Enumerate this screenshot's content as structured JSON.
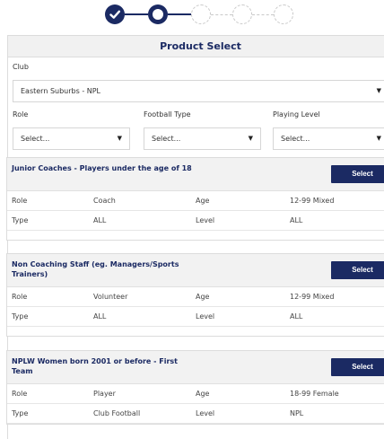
{
  "stepper": {
    "steps": [
      "done",
      "current",
      "todo",
      "todo",
      "todo"
    ],
    "accent": "#1b2a63"
  },
  "panel": {
    "title": "Product Select"
  },
  "filters": {
    "club_label": "Club",
    "club_value": "Eastern Suburbs - NPL",
    "role_label": "Role",
    "role_value": "Select...",
    "football_type_label": "Football Type",
    "football_type_value": "Select...",
    "playing_level_label": "Playing Level",
    "playing_level_value": "Select..."
  },
  "products": [
    {
      "title": "Junior Coaches - Players under the age of 18",
      "button": "Select",
      "role_label": "Role",
      "role": "Coach",
      "age_label": "Age",
      "age": "12-99 Mixed",
      "type_label": "Type",
      "type": "ALL",
      "level_label": "Level",
      "level": "ALL"
    },
    {
      "title": "Non Coaching Staff (eg. Managers/Sports Trainers)",
      "button": "Select",
      "role_label": "Role",
      "role": "Volunteer",
      "age_label": "Age",
      "age": "12-99 Mixed",
      "type_label": "Type",
      "type": "ALL",
      "level_label": "Level",
      "level": "ALL"
    },
    {
      "title": "NPLW Women born 2001 or before - First Team",
      "button": "Select",
      "role_label": "Role",
      "role": "Player",
      "age_label": "Age",
      "age": "18-99 Female",
      "type_label": "Type",
      "type": "Club Football",
      "level_label": "Level",
      "level": "NPL"
    }
  ]
}
